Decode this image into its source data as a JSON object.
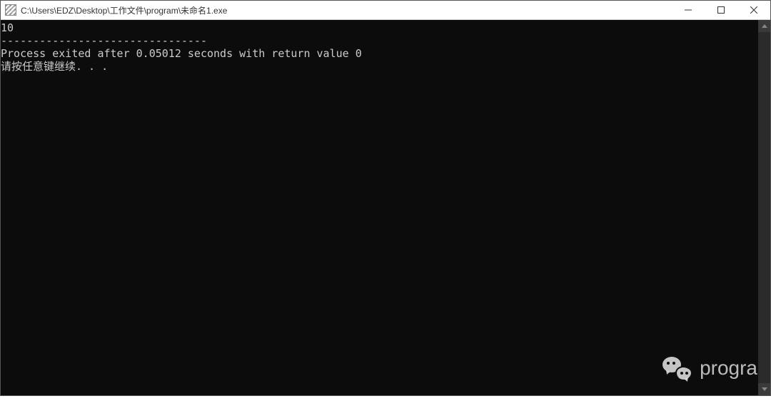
{
  "titlebar": {
    "icon": "console-app-icon",
    "title": "C:\\Users\\EDZ\\Desktop\\工作文件\\program\\未命名1.exe"
  },
  "window_controls": {
    "minimize": "minimize",
    "maximize": "maximize",
    "close": "close"
  },
  "console": {
    "line1": "10",
    "line2": "--------------------------------",
    "line3": "Process exited after 0.05012 seconds with return value 0",
    "line4": "请按任意键继续. . ."
  },
  "watermark": {
    "text": "progra",
    "icon": "wechat-icon"
  }
}
